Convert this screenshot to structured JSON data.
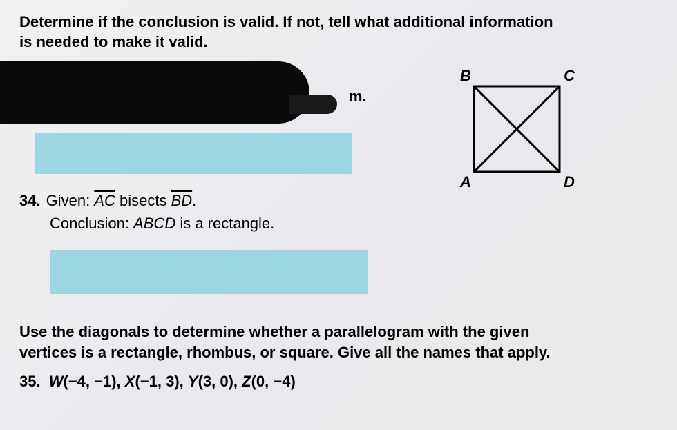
{
  "instructions1_line1": "Determine if the conclusion is valid. If not, tell what additional information",
  "instructions1_line2": "is needed to make it valid.",
  "obscured_suffix": "m.",
  "problem34": {
    "number": "34.",
    "given_label": "Given: ",
    "seg1": "AC",
    "bisects": " bisects ",
    "seg2": "BD",
    "period": ".",
    "conclusion_label": "Conclusion: ",
    "shape": "ABCD",
    "conclusion_rest": " is a rectangle."
  },
  "figure": {
    "B": "B",
    "C": "C",
    "A": "A",
    "D": "D"
  },
  "instructions2_line1": "Use the diagonals to determine whether a parallelogram with the given",
  "instructions2_line2": "vertices is a rectangle, rhombus, or square. Give all the names that apply.",
  "problem35": {
    "number": "35.",
    "W": "W",
    "Wc": "(−4, −1), ",
    "X": "X",
    "Xc": "(−1, 3), ",
    "Y": "Y",
    "Yc": "(3, 0), ",
    "Z": "Z",
    "Zc": "(0, −4)"
  }
}
